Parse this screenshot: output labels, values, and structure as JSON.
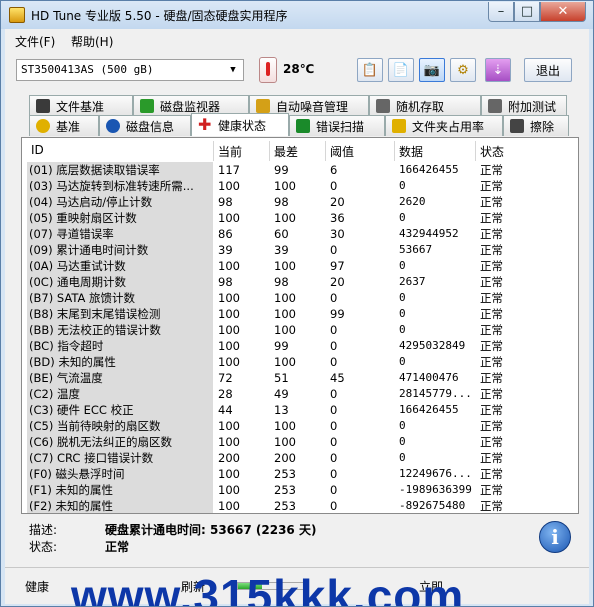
{
  "window": {
    "title": "HD Tune 专业版 5.50 - 硬盘/固态硬盘实用程序"
  },
  "menu": {
    "file": "文件(F)",
    "help": "帮助(H)"
  },
  "toolbar": {
    "drive": "ST3500413AS (500 gB)",
    "temperature": "28℃",
    "exit_label": "退出",
    "icons": [
      "copy-icon",
      "copy-alt-icon",
      "camera-icon",
      "settings-icon",
      "download-icon"
    ]
  },
  "tabs_top": [
    {
      "label": "文件基准",
      "icon": "file-benchmark-icon",
      "color": "#3a3a3a"
    },
    {
      "label": "磁盘监视器",
      "icon": "disk-monitor-icon",
      "color": "#2a9a2a"
    },
    {
      "label": "自动噪音管理",
      "icon": "speaker-icon",
      "color": "#d4a017"
    },
    {
      "label": "随机存取",
      "icon": "random-access-icon",
      "color": "#555"
    },
    {
      "label": "附加测试",
      "icon": "extra-tests-icon",
      "color": "#555"
    }
  ],
  "tabs_bottom": [
    {
      "label": "基准",
      "icon": "bulb-icon",
      "color": "#e0b000"
    },
    {
      "label": "磁盘信息",
      "icon": "info-icon",
      "color": "#1a56b2"
    },
    {
      "label": "健康状态",
      "icon": "health-cross-icon",
      "color": "#d02020"
    },
    {
      "label": "错误扫描",
      "icon": "check-scan-icon",
      "color": "#1a8a2a"
    },
    {
      "label": "文件夹占用率",
      "icon": "folder-icon",
      "color": "#e0b000"
    },
    {
      "label": "擦除",
      "icon": "trash-icon",
      "color": "#444"
    }
  ],
  "table": {
    "headers": {
      "id": "ID",
      "current": "当前",
      "worst": "最差",
      "threshold": "阈值",
      "data": "数据",
      "status": "状态"
    },
    "rows": [
      {
        "id": "(01) 底层数据读取错误率",
        "current": "117",
        "worst": "99",
        "threshold": "6",
        "data": "166426455",
        "status": "正常"
      },
      {
        "id": "(03) 马达旋转到标准转速所需...",
        "current": "100",
        "worst": "100",
        "threshold": "0",
        "data": "0",
        "status": "正常"
      },
      {
        "id": "(04) 马达启动/停止计数",
        "current": "98",
        "worst": "98",
        "threshold": "20",
        "data": "2620",
        "status": "正常"
      },
      {
        "id": "(05) 重映射扇区计数",
        "current": "100",
        "worst": "100",
        "threshold": "36",
        "data": "0",
        "status": "正常"
      },
      {
        "id": "(07) 寻道错误率",
        "current": "86",
        "worst": "60",
        "threshold": "30",
        "data": "432944952",
        "status": "正常"
      },
      {
        "id": "(09) 累计通电时间计数",
        "current": "39",
        "worst": "39",
        "threshold": "0",
        "data": "53667",
        "status": "正常"
      },
      {
        "id": "(0A) 马达重试计数",
        "current": "100",
        "worst": "100",
        "threshold": "97",
        "data": "0",
        "status": "正常"
      },
      {
        "id": "(0C) 通电周期计数",
        "current": "98",
        "worst": "98",
        "threshold": "20",
        "data": "2637",
        "status": "正常"
      },
      {
        "id": "(B7) SATA 旅馈计数",
        "current": "100",
        "worst": "100",
        "threshold": "0",
        "data": "0",
        "status": "正常"
      },
      {
        "id": "(B8) 末尾到末尾错误检测",
        "current": "100",
        "worst": "100",
        "threshold": "99",
        "data": "0",
        "status": "正常"
      },
      {
        "id": "(BB) 无法校正的错误计数",
        "current": "100",
        "worst": "100",
        "threshold": "0",
        "data": "0",
        "status": "正常"
      },
      {
        "id": "(BC) 指令超时",
        "current": "100",
        "worst": "99",
        "threshold": "0",
        "data": "4295032849",
        "status": "正常"
      },
      {
        "id": "(BD) 未知的属性",
        "current": "100",
        "worst": "100",
        "threshold": "0",
        "data": "0",
        "status": "正常"
      },
      {
        "id": "(BE) 气流温度",
        "current": "72",
        "worst": "51",
        "threshold": "45",
        "data": "471400476",
        "status": "正常"
      },
      {
        "id": "(C2) 温度",
        "current": "28",
        "worst": "49",
        "threshold": "0",
        "data": "28145779...",
        "status": "正常"
      },
      {
        "id": "(C3) 硬件 ECC 校正",
        "current": "44",
        "worst": "13",
        "threshold": "0",
        "data": "166426455",
        "status": "正常"
      },
      {
        "id": "(C5) 当前待映射的扇区数",
        "current": "100",
        "worst": "100",
        "threshold": "0",
        "data": "0",
        "status": "正常"
      },
      {
        "id": "(C6) 脱机无法纠正的扇区数",
        "current": "100",
        "worst": "100",
        "threshold": "0",
        "data": "0",
        "status": "正常"
      },
      {
        "id": "(C7) CRC 接口错误计数",
        "current": "200",
        "worst": "200",
        "threshold": "0",
        "data": "0",
        "status": "正常"
      },
      {
        "id": "(F0) 磁头悬浮时间",
        "current": "100",
        "worst": "253",
        "threshold": "0",
        "data": "12249676...",
        "status": "正常"
      },
      {
        "id": "(F1) 未知的属性",
        "current": "100",
        "worst": "253",
        "threshold": "0",
        "data": "-1989636399",
        "status": "正常"
      },
      {
        "id": "(F2) 未知的属性",
        "current": "100",
        "worst": "253",
        "threshold": "0",
        "data": "-892675480",
        "status": "正常"
      }
    ]
  },
  "description": {
    "desc_label": "描述:",
    "desc_value": "硬盘累计通电时间: 53667 (2236 天)",
    "status_label": "状态:",
    "status_value": "正常"
  },
  "bottom": {
    "left_label": "健康",
    "mid_label": "刷新",
    "right_label": "立即",
    "progress": 0.35,
    "watermark": "www.315kkk.com"
  }
}
